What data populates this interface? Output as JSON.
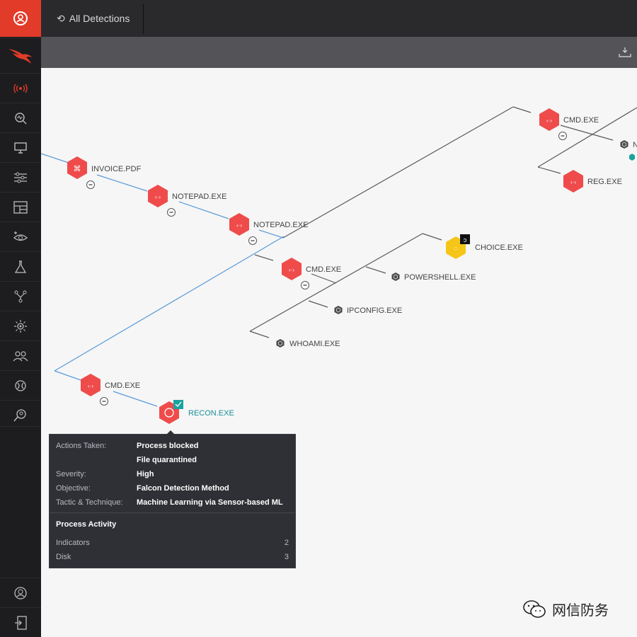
{
  "header": {
    "back_label": "All Detections",
    "back_icon": "undo-arrow-icon"
  },
  "sidebar": {
    "items": [
      {
        "name": "user-circle-icon"
      },
      {
        "name": "falcon-logo"
      },
      {
        "name": "broadcast-icon"
      },
      {
        "name": "search-activity-icon"
      },
      {
        "name": "monitor-icon"
      },
      {
        "name": "sliders-icon"
      },
      {
        "name": "dashboard-icon"
      },
      {
        "name": "eye-plus-icon"
      },
      {
        "name": "flask-icon"
      },
      {
        "name": "branch-icon"
      },
      {
        "name": "sun-target-icon"
      },
      {
        "name": "users-icon"
      },
      {
        "name": "gear-icon"
      },
      {
        "name": "search-user-icon"
      },
      {
        "name": "account-icon"
      },
      {
        "name": "logout-icon"
      }
    ]
  },
  "graph": {
    "colors": {
      "red": "#ef4b4b",
      "yellow": "#f5c518",
      "dark": "#4a4a4d",
      "teal": "#1aa39e",
      "blue_line": "#5b9bd9",
      "gray_line": "#5a5a5e"
    },
    "nodes": {
      "invoice": "INVOICE.PDF",
      "notepad1": "NOTEPAD.EXE",
      "notepad2": "NOTEPAD.EXE",
      "cmd_mid": "CMD.EXE",
      "choice": "CHOICE.EXE",
      "powershell": "POWERSHELL.EXE",
      "ipconfig": "IPCONFIG.EXE",
      "whoami": "WHOAMI.EXE",
      "cmd_low": "CMD.EXE",
      "recon": "RECON.EXE",
      "cmd_top": "CMD.EXE",
      "reg": "REG.EXE",
      "partial": "N"
    }
  },
  "tooltip": {
    "rows": [
      {
        "key": "Actions Taken:",
        "value": "Process blocked"
      },
      {
        "key": "",
        "value": "File quarantined"
      },
      {
        "key": "Severity:",
        "value": "High"
      },
      {
        "key": "Objective:",
        "value": "Falcon Detection Method"
      },
      {
        "key": "Tactic & Technique:",
        "value": "Machine Learning via Sensor-based ML"
      }
    ],
    "section_title": "Process Activity",
    "activity": [
      {
        "label": "Indicators",
        "count": "2"
      },
      {
        "label": "Disk",
        "count": "3"
      }
    ]
  },
  "watermark": {
    "text": "网信防务"
  }
}
